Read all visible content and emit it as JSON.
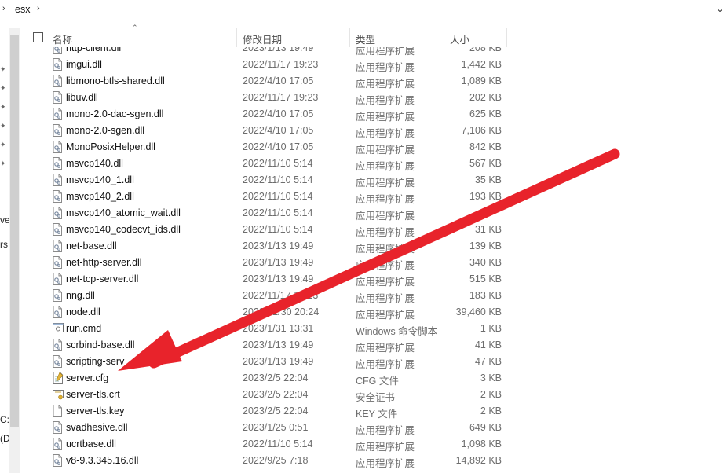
{
  "breadcrumb": {
    "folder": "esx"
  },
  "nav": {
    "fragment_1": "ve",
    "fragment_2": "rs",
    "fragment_3": "C:",
    "fragment_4": "(D"
  },
  "columns": {
    "name": "名称",
    "date": "修改日期",
    "type": "类型",
    "size": "大小"
  },
  "files": [
    {
      "name": "http-client.dll",
      "date": "2023/1/13 19:49",
      "type": "应用程序扩展",
      "size": "208 KB",
      "icon": "dll"
    },
    {
      "name": "imgui.dll",
      "date": "2022/11/17 19:23",
      "type": "应用程序扩展",
      "size": "1,442 KB",
      "icon": "dll"
    },
    {
      "name": "libmono-btls-shared.dll",
      "date": "2022/4/10 17:05",
      "type": "应用程序扩展",
      "size": "1,089 KB",
      "icon": "dll"
    },
    {
      "name": "libuv.dll",
      "date": "2022/11/17 19:23",
      "type": "应用程序扩展",
      "size": "202 KB",
      "icon": "dll"
    },
    {
      "name": "mono-2.0-dac-sgen.dll",
      "date": "2022/4/10 17:05",
      "type": "应用程序扩展",
      "size": "625 KB",
      "icon": "dll"
    },
    {
      "name": "mono-2.0-sgen.dll",
      "date": "2022/4/10 17:05",
      "type": "应用程序扩展",
      "size": "7,106 KB",
      "icon": "dll"
    },
    {
      "name": "MonoPosixHelper.dll",
      "date": "2022/4/10 17:05",
      "type": "应用程序扩展",
      "size": "842 KB",
      "icon": "dll"
    },
    {
      "name": "msvcp140.dll",
      "date": "2022/11/10 5:14",
      "type": "应用程序扩展",
      "size": "567 KB",
      "icon": "dll"
    },
    {
      "name": "msvcp140_1.dll",
      "date": "2022/11/10 5:14",
      "type": "应用程序扩展",
      "size": "35 KB",
      "icon": "dll"
    },
    {
      "name": "msvcp140_2.dll",
      "date": "2022/11/10 5:14",
      "type": "应用程序扩展",
      "size": "193 KB",
      "icon": "dll"
    },
    {
      "name": "msvcp140_atomic_wait.dll",
      "date": "2022/11/10 5:14",
      "type": "应用程序扩展",
      "size": "",
      "icon": "dll"
    },
    {
      "name": "msvcp140_codecvt_ids.dll",
      "date": "2022/11/10 5:14",
      "type": "应用程序扩展",
      "size": "31 KB",
      "icon": "dll"
    },
    {
      "name": "net-base.dll",
      "date": "2023/1/13 19:49",
      "type": "应用程序扩展",
      "size": "139 KB",
      "icon": "dll"
    },
    {
      "name": "net-http-server.dll",
      "date": "2023/1/13 19:49",
      "type": "应用程序扩展",
      "size": "340 KB",
      "icon": "dll"
    },
    {
      "name": "net-tcp-server.dll",
      "date": "2023/1/13 19:49",
      "type": "应用程序扩展",
      "size": "515 KB",
      "icon": "dll"
    },
    {
      "name": "nng.dll",
      "date": "2022/11/17 19:23",
      "type": "应用程序扩展",
      "size": "183 KB",
      "icon": "dll"
    },
    {
      "name": "node.dll",
      "date": "2022/12/30 20:24",
      "type": "应用程序扩展",
      "size": "39,460 KB",
      "icon": "dll"
    },
    {
      "name": "run.cmd",
      "date": "2023/1/31 13:31",
      "type": "Windows 命令脚本",
      "size": "1 KB",
      "icon": "cmd"
    },
    {
      "name": "scrbind-base.dll",
      "date": "2023/1/13 19:49",
      "type": "应用程序扩展",
      "size": "41 KB",
      "icon": "dll"
    },
    {
      "name": "scripting-serv",
      "date": "2023/1/13 19:49",
      "type": "应用程序扩展",
      "size": "47 KB",
      "icon": "dll"
    },
    {
      "name": "server.cfg",
      "date": "2023/2/5 22:04",
      "type": "CFG 文件",
      "size": "3 KB",
      "icon": "cfg"
    },
    {
      "name": "server-tls.crt",
      "date": "2023/2/5 22:04",
      "type": "安全证书",
      "size": "2 KB",
      "icon": "crt"
    },
    {
      "name": "server-tls.key",
      "date": "2023/2/5 22:04",
      "type": "KEY 文件",
      "size": "2 KB",
      "icon": "blank"
    },
    {
      "name": "svadhesive.dll",
      "date": "2023/1/25 0:51",
      "type": "应用程序扩展",
      "size": "649 KB",
      "icon": "dll"
    },
    {
      "name": "ucrtbase.dll",
      "date": "2022/11/10 5:14",
      "type": "应用程序扩展",
      "size": "1,098 KB",
      "icon": "dll"
    },
    {
      "name": "v8-9.3.345.16.dll",
      "date": "2022/9/25 7:18",
      "type": "应用程序扩展",
      "size": "14,892 KB",
      "icon": "dll"
    }
  ],
  "annotation": {
    "color": "#e8232b",
    "target_file": "server.cfg"
  }
}
